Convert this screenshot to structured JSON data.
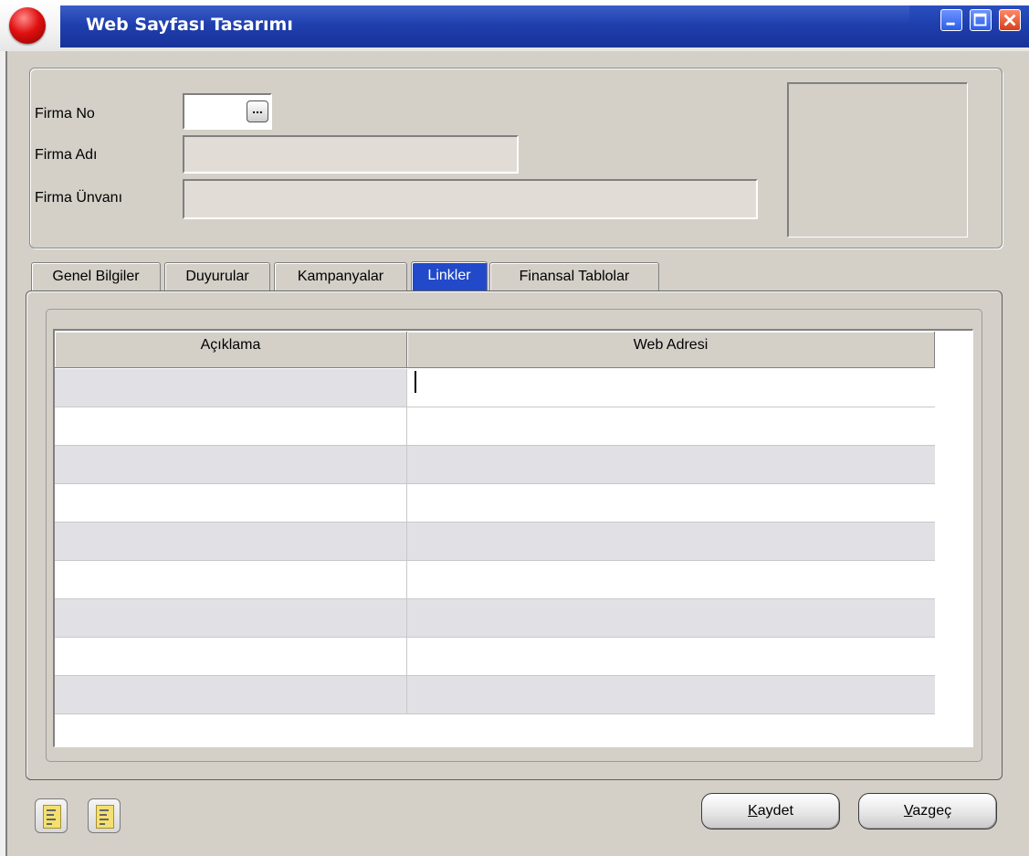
{
  "window": {
    "title": "Web Sayfası Tasarımı"
  },
  "form": {
    "firma_no_label": "Firma No",
    "firma_no_value": "",
    "firma_adi_label": "Firma Adı",
    "firma_adi_value": "",
    "firma_unvani_label": "Firma Ünvanı",
    "firma_unvani_value": "",
    "lookup_button": "..."
  },
  "tabs": [
    {
      "label": "Genel Bilgiler",
      "active": false
    },
    {
      "label": "Duyurular",
      "active": false
    },
    {
      "label": "Kampanyalar",
      "active": false
    },
    {
      "label": "Linkler",
      "active": true
    },
    {
      "label": "Finansal Tablolar",
      "active": false
    }
  ],
  "grid": {
    "columns": [
      "Açıklama",
      "Web Adresi"
    ],
    "rows": [
      [
        "",
        ""
      ],
      [
        "",
        ""
      ],
      [
        "",
        ""
      ],
      [
        "",
        ""
      ],
      [
        "",
        ""
      ],
      [
        "",
        ""
      ],
      [
        "",
        ""
      ],
      [
        "",
        ""
      ],
      [
        "",
        ""
      ]
    ]
  },
  "buttons": {
    "save_accel": "K",
    "save_rest": "aydet",
    "cancel_accel": "V",
    "cancel_rest": "azgeç"
  },
  "icons": [
    "app-icon",
    "minimize-icon",
    "maximize-icon",
    "close-icon",
    "document-icon",
    "document-icon"
  ]
}
